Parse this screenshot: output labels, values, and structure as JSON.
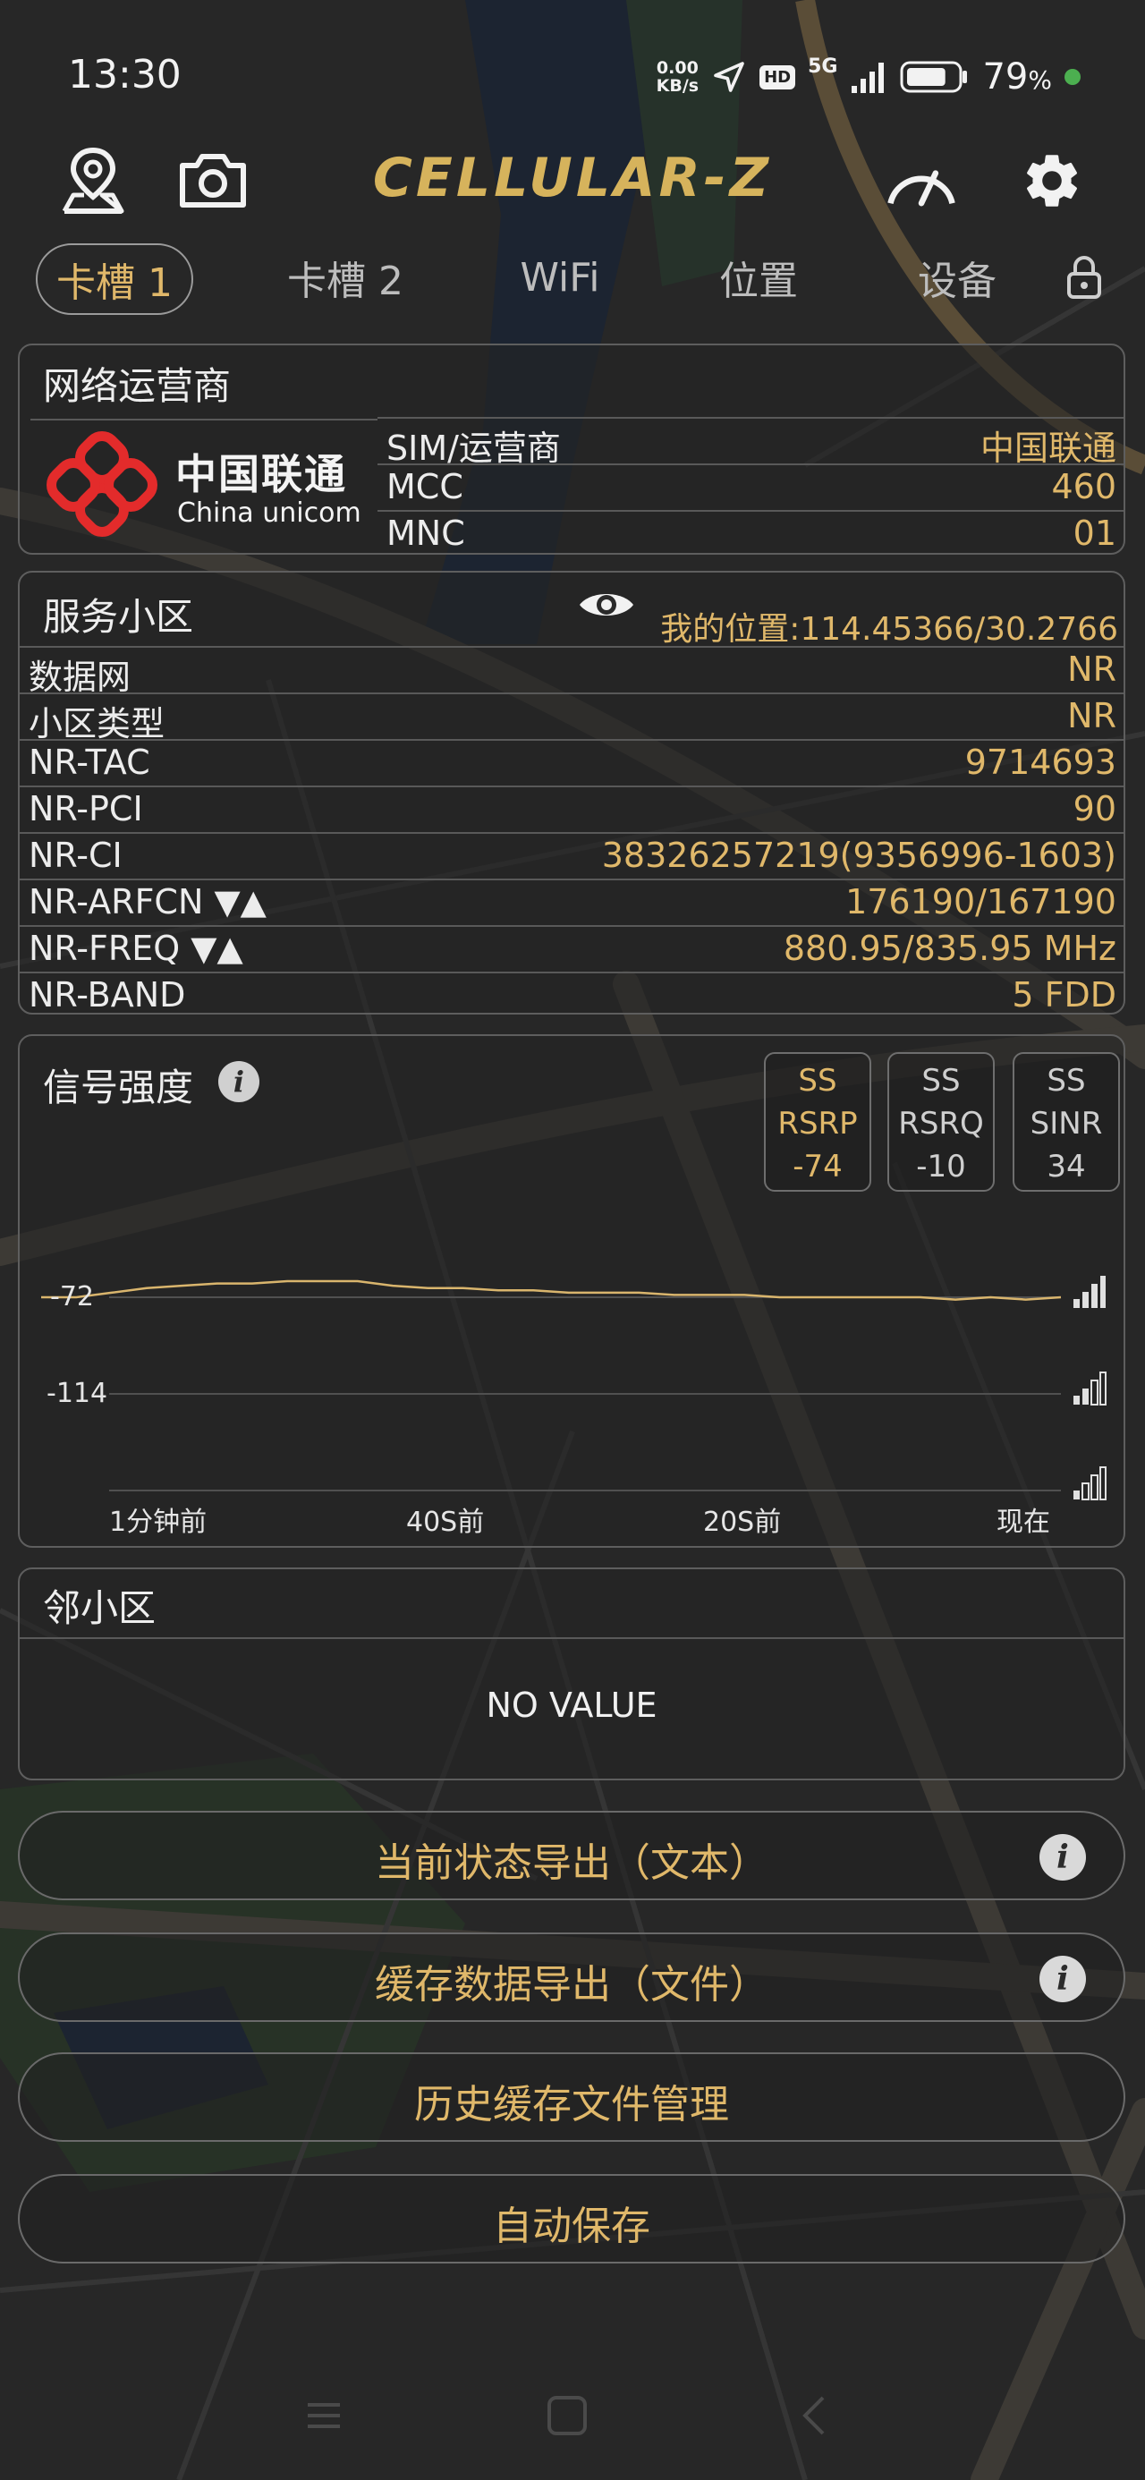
{
  "status_bar": {
    "time": "13:30",
    "net_speed_value": "0.00",
    "net_speed_unit": "KB/s",
    "hd_badge": "HD",
    "network_type": "5G",
    "battery_percent": "79",
    "percent_sign": "%"
  },
  "app_bar": {
    "logo": "CELLULAR-Z",
    "icons": [
      "map-pin-icon",
      "camera-icon",
      "speedometer-icon",
      "gear-icon"
    ]
  },
  "tabs": [
    {
      "label": "卡槽 1",
      "active": true
    },
    {
      "label": "卡槽 2",
      "active": false
    },
    {
      "label": "WiFi",
      "active": false
    },
    {
      "label": "位置",
      "active": false
    },
    {
      "label": "设备",
      "active": false
    }
  ],
  "operator": {
    "title": "网络运营商",
    "logo_cn": "中国联通",
    "logo_en": "China unicom",
    "rows": [
      {
        "key": "SIM/运营商",
        "value": "中国联通"
      },
      {
        "key": "MCC",
        "value": "460"
      },
      {
        "key": "MNC",
        "value": "01"
      }
    ]
  },
  "service_cell": {
    "title": "服务小区",
    "location": "我的位置:114.45366/30.2766",
    "rows": [
      {
        "key": "数据网",
        "value": "NR"
      },
      {
        "key": "小区类型",
        "value": "NR"
      },
      {
        "key": "NR-TAC",
        "value": "9714693"
      },
      {
        "key": "NR-PCI",
        "value": "90"
      },
      {
        "key": "NR-CI",
        "value": "38326257219(9356996-1603)"
      },
      {
        "key": "NR-ARFCN ▼▲",
        "value": "176190/167190"
      },
      {
        "key": "NR-FREQ ▼▲",
        "value": "880.95/835.95 MHz"
      },
      {
        "key": "NR-BAND",
        "value": "5 FDD"
      }
    ]
  },
  "signal": {
    "title": "信号强度",
    "badges": [
      {
        "l1": "SS",
        "l2": "RSRP",
        "value": "-74",
        "highlight": true
      },
      {
        "l1": "SS",
        "l2": "RSRQ",
        "value": "-10",
        "highlight": false
      },
      {
        "l1": "SS",
        "l2": "SINR",
        "value": "34",
        "highlight": false
      }
    ]
  },
  "chart_data": {
    "type": "line",
    "series": [
      {
        "values": [
          -72,
          -72,
          -70,
          -68,
          -67,
          -66,
          -66,
          -65,
          -65,
          -65,
          -67,
          -68,
          -68,
          -69,
          -69,
          -70,
          -70,
          -70,
          -71,
          -71,
          -71,
          -72,
          -72,
          -72,
          -72,
          -72,
          -73,
          -72,
          -73,
          -72
        ]
      }
    ],
    "x_tick_labels": [
      "1分钟前",
      "40S前",
      "20S前",
      "现在"
    ],
    "y_tick_labels": [
      "-72",
      "-114"
    ],
    "ylim": [
      -156,
      -50
    ],
    "grid": true,
    "line_color": "#d9b56d"
  },
  "neighbor": {
    "title": "邻小区",
    "empty_text": "NO VALUE"
  },
  "buttons": [
    {
      "label": "当前状态导出（文本）",
      "info": true
    },
    {
      "label": "缓存数据导出（文件）",
      "info": true
    },
    {
      "label": "历史缓存文件管理",
      "info": false
    },
    {
      "label": "自动保存",
      "info": false
    }
  ],
  "info_glyph": "i"
}
